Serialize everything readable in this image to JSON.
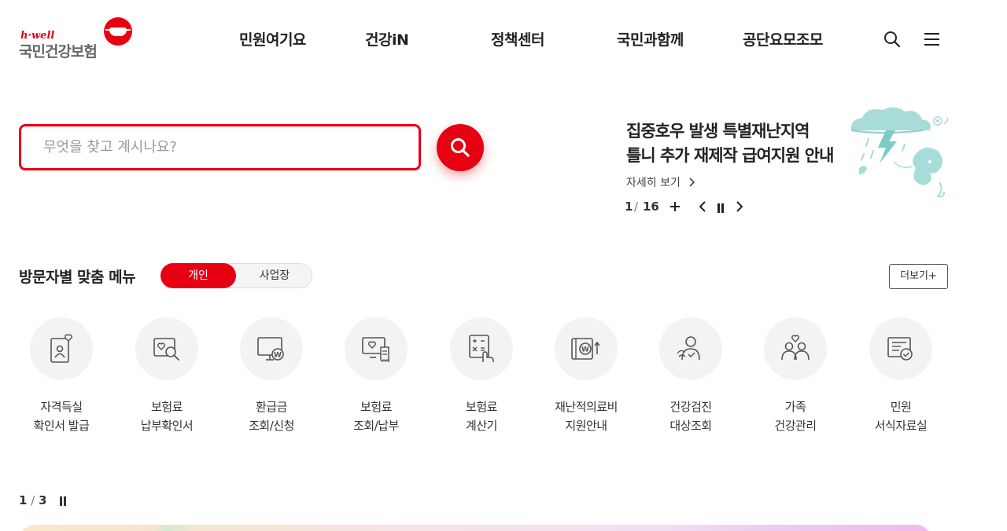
{
  "header": {
    "logo": {
      "tagline": "h·well",
      "name": "국민건강보험"
    },
    "nav": [
      "민원여기요",
      "건강iN",
      "정책센터",
      "국민과함께",
      "공단요모조모"
    ],
    "icons": [
      "search-icon",
      "hamburger-menu-icon"
    ]
  },
  "search": {
    "placeholder": "무엇을 찾고 계시나요?",
    "value": ""
  },
  "notice": {
    "title_line1": "집중호우 발생 특별재난지역",
    "title_line2": "틀니 추가 재제작 급여지원 안내",
    "more": "자세히 보기",
    "current": "1",
    "total": "16"
  },
  "custom_menu": {
    "title": "방문자별 맞춤 메뉴",
    "tabs": [
      "개인",
      "사업장"
    ],
    "selected_tab": "개인",
    "more_button": "더보기+",
    "items": [
      {
        "line1": "자격득실",
        "line2": "확인서 발급",
        "icon": "id-card-heart-icon"
      },
      {
        "line1": "보험료",
        "line2": "납부확인서",
        "icon": "document-search-icon"
      },
      {
        "line1": "환급금",
        "line2": "조회/신청",
        "icon": "monitor-won-icon"
      },
      {
        "line1": "보험료",
        "line2": "조회/납부",
        "icon": "monitor-receipt-icon"
      },
      {
        "line1": "보험료",
        "line2": "계산기",
        "icon": "calculator-icon"
      },
      {
        "line1": "재난적의료비",
        "line2": "지원안내",
        "icon": "won-transfer-icon"
      },
      {
        "line1": "건강검진",
        "line2": "대상조회",
        "icon": "person-check-icon"
      },
      {
        "line1": "가족",
        "line2": "건강관리",
        "icon": "family-heart-icon"
      },
      {
        "line1": "민원",
        "line2": "서식자료실",
        "icon": "form-document-icon"
      }
    ],
    "pager_current": "1",
    "pager_total": "3"
  },
  "colors": {
    "accent": "#e60012",
    "text": "#222222",
    "icon_bg": "#f3f3f3",
    "icon_stroke": "#555555"
  }
}
